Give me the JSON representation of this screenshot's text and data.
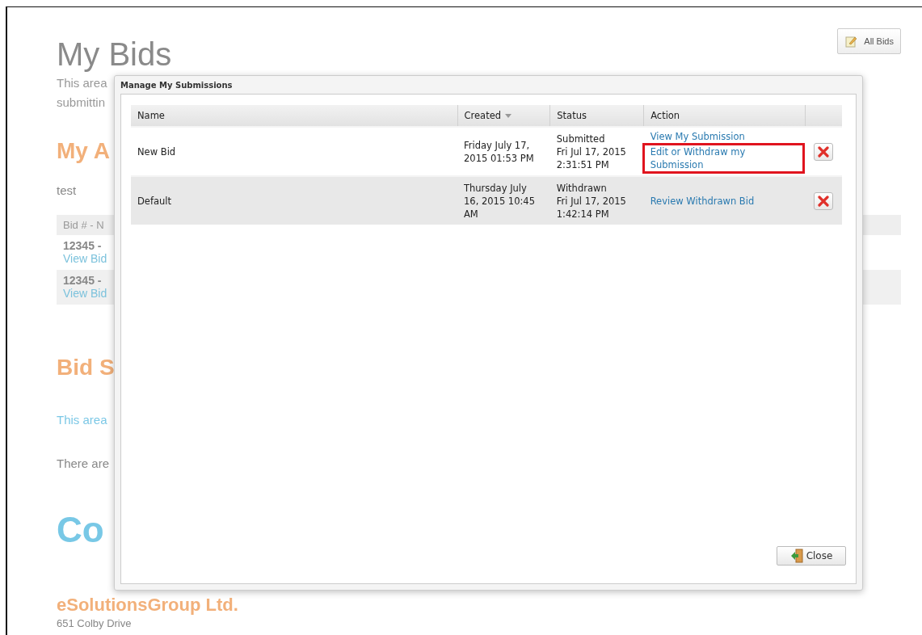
{
  "page": {
    "title": "My Bids",
    "all_bids_button": "All Bids",
    "intro_lines": [
      "This area",
      "submittin"
    ],
    "account_heading": "My A",
    "account_text": "test",
    "bids_table": {
      "header": "Bid # - N",
      "rows": [
        {
          "title": "12345 -",
          "link": "View Bid"
        },
        {
          "title": "12345 -",
          "link": "View Bid"
        }
      ]
    },
    "summary_heading": "Bid S",
    "summary_link": "This area",
    "summary_text": "There are",
    "contact_heading": "Co",
    "company": "eSolutionsGroup Ltd.",
    "address": "651 Colby Drive"
  },
  "dialog": {
    "title": "Manage My Submissions",
    "columns": [
      {
        "label": "Name",
        "sorted": false
      },
      {
        "label": "Created",
        "sorted": true
      },
      {
        "label": "Status",
        "sorted": false
      },
      {
        "label": "Action",
        "sorted": false
      }
    ],
    "rows": [
      {
        "name": "New Bid",
        "created": "Friday July 17, 2015 01:53 PM",
        "status": "Submitted",
        "status_time": "Fri Jul 17, 2015 2:31:51 PM",
        "actions": [
          {
            "text": "View My Submission",
            "highlighted": false
          },
          {
            "text": "Edit or Withdraw my Submission",
            "highlighted": true
          }
        ]
      },
      {
        "name": "Default",
        "created": "Thursday July 16, 2015 10:45 AM",
        "status": "Withdrawn",
        "status_time": "Fri Jul 17, 2015 1:42:14 PM",
        "actions": [
          {
            "text": "Review Withdrawn Bid",
            "highlighted": false
          }
        ]
      }
    ],
    "close_button": "Close"
  }
}
